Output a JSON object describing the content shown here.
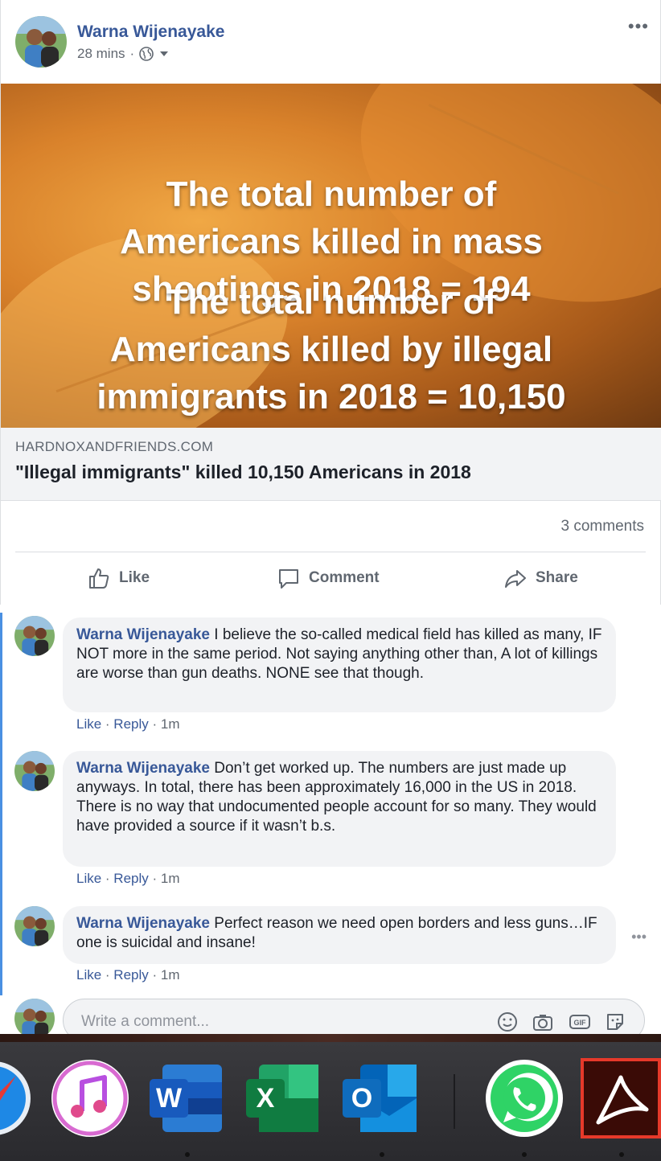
{
  "post": {
    "author": "Warna Wijenayake",
    "time": "28 mins",
    "meta_separator": "·",
    "more": "•••",
    "image_text_1": [
      "The total number of",
      "Americans killed in mass",
      "shootings in 2018 = 194"
    ],
    "image_text_2": [
      "The total number of",
      "Americans killed by illegal",
      "immigrants in 2018 = 10,150"
    ],
    "link_domain": "HARDNOXANDFRIENDS.COM",
    "link_title": "\"Illegal immigrants\" killed 10,150 Americans in 2018",
    "comment_count": "3 comments",
    "actions": {
      "like": "Like",
      "comment": "Comment",
      "share": "Share"
    }
  },
  "comments": [
    {
      "author": "Warna Wijenayake",
      "text": "I believe the so-called medical field has killed as many, IF NOT more in the same period. Not saying anything other than, A lot of killings are worse than gun deaths. NONE see that though.",
      "like": "Like",
      "reply": "Reply",
      "time": "1m"
    },
    {
      "author": "Warna Wijenayake",
      "text": "Don’t get worked up. The numbers are just made up anyways. In total, there has been approximately 16,000 in the US in 2018. There is no way that undocumented people account for so many. They would have provided a source if it wasn’t b.s.",
      "like": "Like",
      "reply": "Reply",
      "time": "1m"
    },
    {
      "author": "Warna Wijenayake",
      "text": "Perfect reason we need open borders and less guns…IF one is suicidal and insane!",
      "like": "Like",
      "reply": "Reply",
      "time": "1m"
    }
  ],
  "write_comment": {
    "placeholder": "Write a comment...",
    "gif_label": "GIF"
  },
  "dock": {
    "apps": [
      "safari-icon",
      "itunes-icon",
      "word-icon",
      "excel-icon",
      "outlook-icon",
      "whatsapp-icon",
      "acrobat-icon"
    ],
    "word_letter": "W",
    "excel_letter": "X",
    "outlook_letter": "O"
  },
  "colors": {
    "link_blue": "#385898",
    "bubble": "#f2f3f5",
    "rail": "#4a90e2"
  }
}
